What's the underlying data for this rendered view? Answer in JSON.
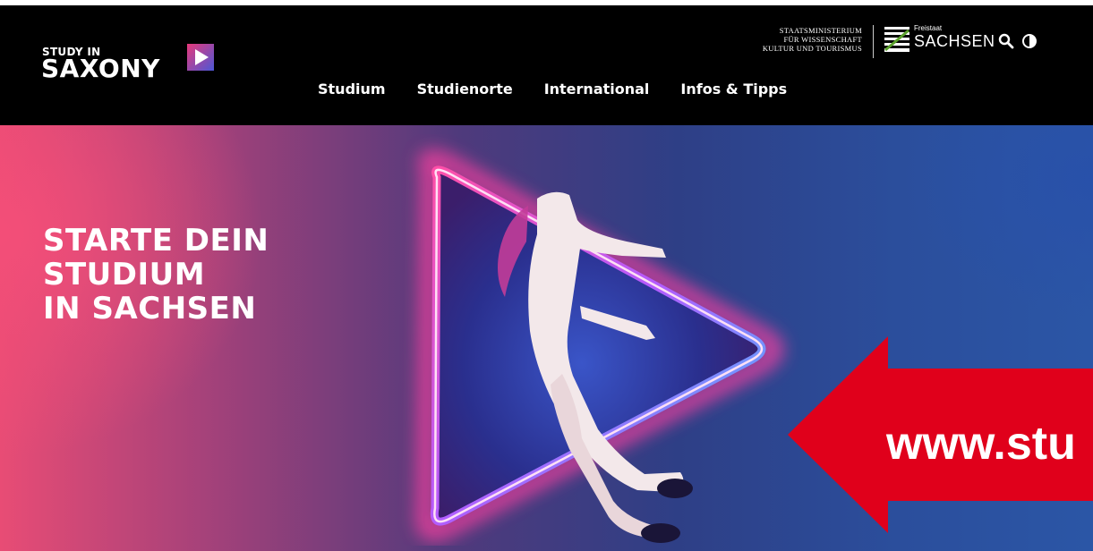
{
  "header": {
    "logo": {
      "line1": "STUDY IN",
      "line2": "SAXONY"
    },
    "nav": [
      {
        "label": "Studium"
      },
      {
        "label": "Studienorte"
      },
      {
        "label": "International"
      },
      {
        "label": "Infos & Tipps"
      }
    ],
    "ministry": {
      "line1": "STAATSMINISTERIUM",
      "line2": "FÜR WISSENSCHAFT",
      "line3": "KULTUR UND TOURISMUS"
    },
    "state": {
      "small": "Freistaat",
      "name": "SACHSEN"
    },
    "icons": {
      "search": "search-icon",
      "contrast": "contrast-icon"
    }
  },
  "hero": {
    "title_lines": [
      "STARTE DEIN",
      "STUDIUM",
      "IN SACHSEN"
    ]
  },
  "overlay": {
    "arrow_text": "www.stu",
    "arrow_color": "#e0001b"
  },
  "colors": {
    "header_bg": "#000000",
    "logo_accent_pink": "#e8397a",
    "logo_accent_blue": "#4b57d6",
    "hero_pink": "#e84c75",
    "hero_blue": "#2b56a6"
  }
}
